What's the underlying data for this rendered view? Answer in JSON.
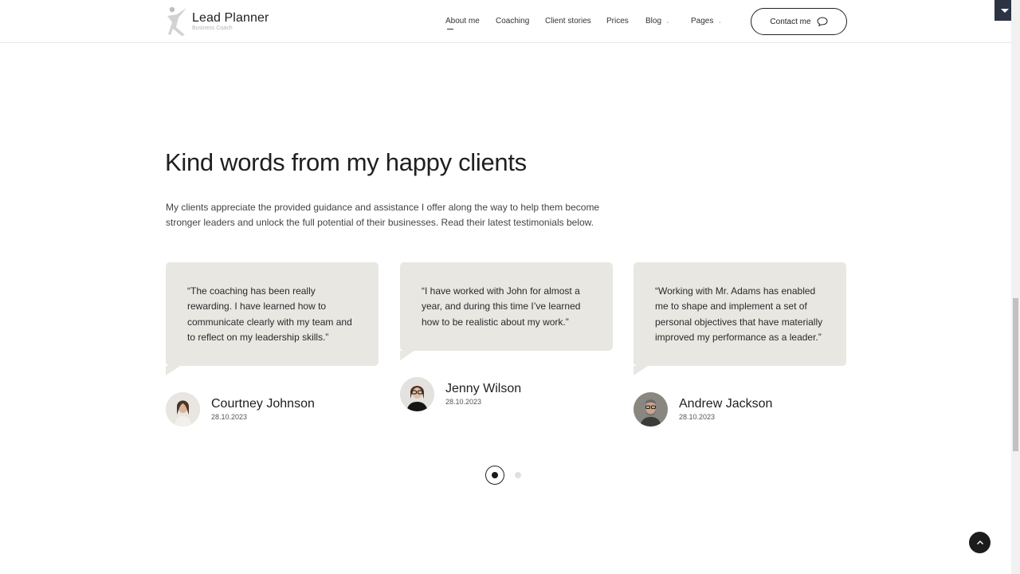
{
  "brand": {
    "title": "Lead Planner",
    "subtitle": "Business Coach"
  },
  "nav": {
    "items": [
      {
        "label": "About me"
      },
      {
        "label": "Coaching"
      },
      {
        "label": "Client stories"
      },
      {
        "label": "Prices"
      },
      {
        "label": "Blog"
      },
      {
        "label": "Pages"
      }
    ],
    "contact_label": "Contact me"
  },
  "section": {
    "heading": "Kind words from my happy clients",
    "intro": "My clients appreciate the provided guidance and assistance I offer along the way to help them become stronger leaders and unlock the full potential of their businesses. Read their latest testimonials below."
  },
  "testimonials": [
    {
      "quote": "“The coaching has been really rewarding. I have learned how to communicate clearly with my team and to reflect on my leadership skills.”",
      "name": "Courtney Johnson",
      "date": "28.10.2023"
    },
    {
      "quote": "“I have worked with John for almost a year, and during this time I’ve learned how to be realistic about my work.”",
      "name": "Jenny Wilson",
      "date": "28.10.2023"
    },
    {
      "quote": "“Working with Mr. Adams has enabled me to shape and implement a set of personal objectives that have materially improved my performance as a leader.”",
      "name": "Andrew Jackson",
      "date": "28.10.2023"
    }
  ],
  "pager": {
    "active_page": 1,
    "total_pages": 2
  },
  "icons": {
    "logo": "running-figure-logo-icon",
    "contact": "speech-bubble-icon",
    "back_to_top": "chevron-up-icon",
    "corner": "caret-down-icon"
  },
  "colors": {
    "card_bg": "#e8e7e2",
    "accent_dark": "#1c1c1c",
    "corner_widget": "#2c3343"
  }
}
